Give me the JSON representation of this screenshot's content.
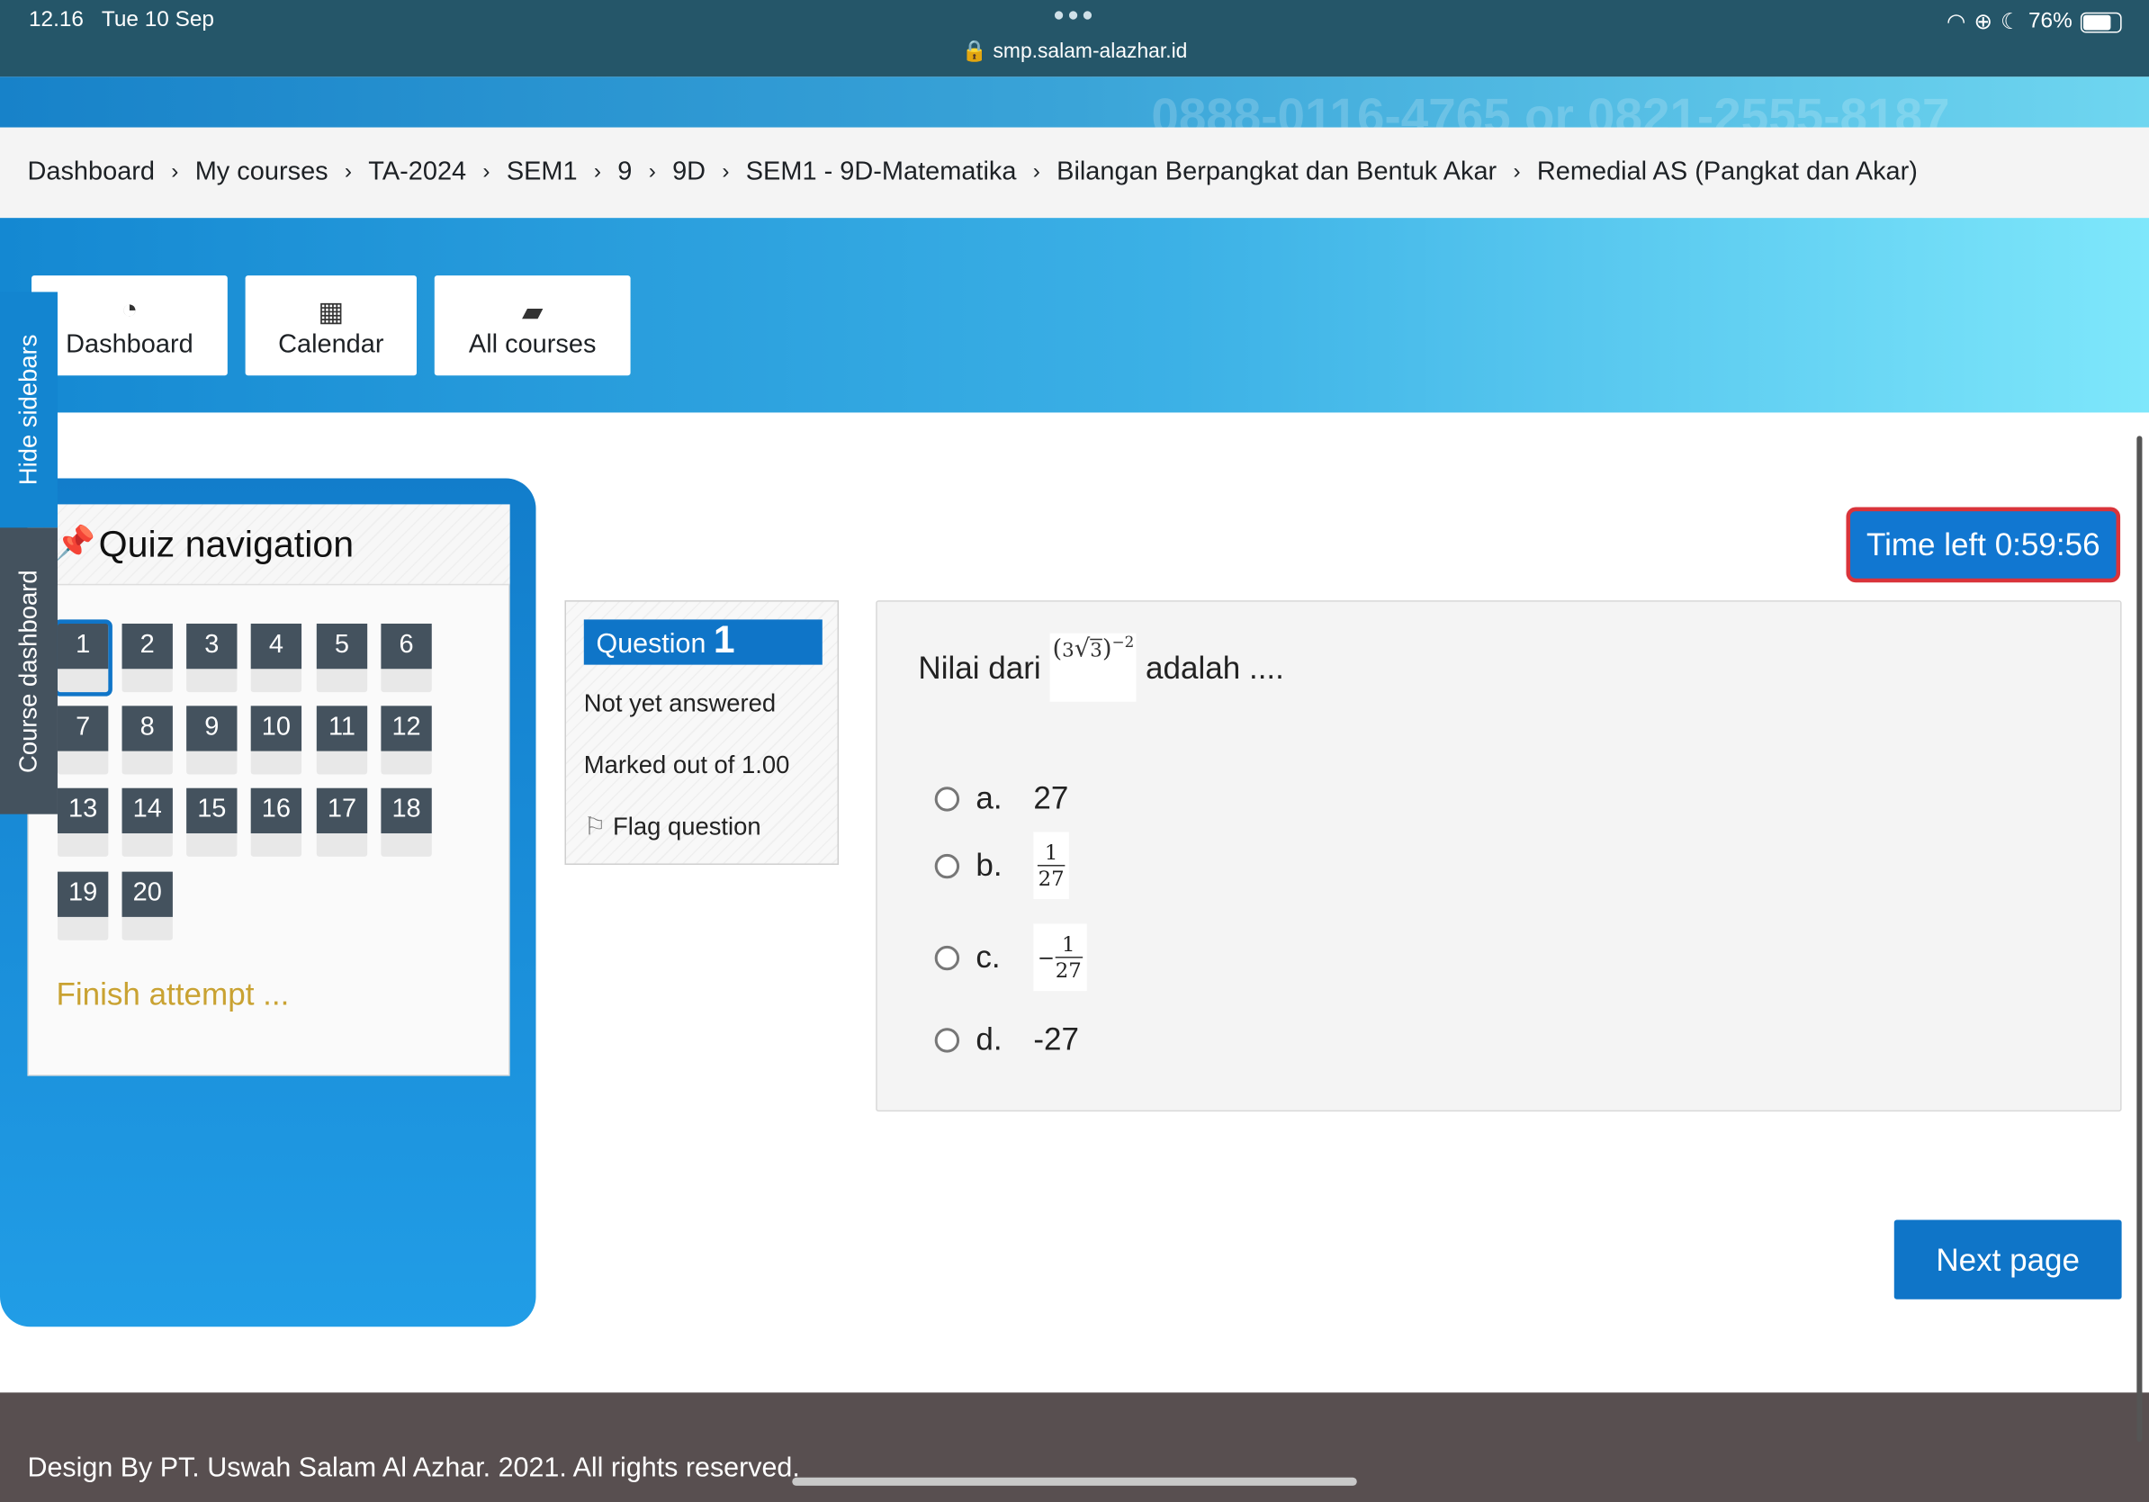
{
  "status_bar": {
    "time": "12.16",
    "date": "Tue 10 Sep",
    "url": "smp.salam-alazhar.id",
    "battery": "76%",
    "battery_level": 0.76
  },
  "banner": {
    "text": "0888-0116-4765 or 0821-2555-8187"
  },
  "breadcrumb": [
    "Dashboard",
    "My courses",
    "TA-2024",
    "SEM1",
    "9",
    "9D",
    "SEM1 - 9D-Matematika",
    "Bilangan Berpangkat dan Bentuk Akar",
    "Remedial AS (Pangkat dan Akar)"
  ],
  "header_buttons": [
    {
      "label": "Dashboard",
      "icon": "dashboard-icon"
    },
    {
      "label": "Calendar",
      "icon": "calendar-icon"
    },
    {
      "label": "All courses",
      "icon": "book-icon"
    }
  ],
  "side_tabs": {
    "hide": "Hide sidebars",
    "course": "Course dashboard"
  },
  "quiz_nav": {
    "title": "Quiz navigation",
    "questions": [
      "1",
      "2",
      "3",
      "4",
      "5",
      "6",
      "7",
      "8",
      "9",
      "10",
      "11",
      "12",
      "13",
      "14",
      "15",
      "16",
      "17",
      "18",
      "19",
      "20"
    ],
    "current": "1",
    "finish": "Finish attempt ..."
  },
  "question_info": {
    "label": "Question",
    "number": "1",
    "status": "Not yet answered",
    "marks": "Marked out of 1.00",
    "flag": "Flag question"
  },
  "timer": {
    "text": "Time left 0:59:56"
  },
  "question": {
    "prefix": "Nilai dari",
    "base": "3",
    "radicand": "3",
    "exponent": "−2",
    "suffix": "adalah ....",
    "options": [
      {
        "letter": "a.",
        "value": "27"
      },
      {
        "letter": "b.",
        "num": "1",
        "den": "27"
      },
      {
        "letter": "c.",
        "sign": "−",
        "num": "1",
        "den": "27"
      },
      {
        "letter": "d.",
        "value": "-27"
      }
    ]
  },
  "next_button": "Next page",
  "footer": "Design By PT. Uswah Salam Al Azhar. 2021. All rights reserved.",
  "colors": {
    "primary": "#0f75c8",
    "nav_dark": "#44525e",
    "timer_border": "#d9343b",
    "finish": "#c9a232",
    "footer": "#584f50"
  }
}
